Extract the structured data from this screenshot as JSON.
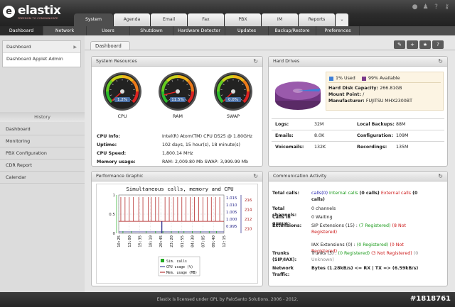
{
  "app": {
    "name": "elastix",
    "tagline": "FREEDOM TO COMMUNICATE"
  },
  "tabs": [
    {
      "label": "System",
      "active": true
    },
    {
      "label": "Agenda",
      "active": false
    },
    {
      "label": "Email",
      "active": false
    },
    {
      "label": "Fax",
      "active": false
    },
    {
      "label": "PBX",
      "active": false
    },
    {
      "label": "IM",
      "active": false
    },
    {
      "label": "Reports",
      "active": false
    }
  ],
  "top_icons": [
    "drop-icon",
    "user-icon",
    "question-icon",
    "key-icon"
  ],
  "subnav": [
    {
      "label": "Dashboard",
      "active": true
    },
    {
      "label": "Network",
      "active": false
    },
    {
      "label": "Users",
      "active": false
    },
    {
      "label": "Shutdown",
      "active": false
    },
    {
      "label": "Hardware Detector",
      "active": false
    },
    {
      "label": "Updates",
      "active": false
    },
    {
      "label": "Backup/Restore",
      "active": false
    },
    {
      "label": "Preferences",
      "active": false
    }
  ],
  "sidebar": {
    "items": [
      "Dashboard",
      "Dashboard Applet Admin"
    ],
    "history_title": "History",
    "history": [
      "Dashboard",
      "Monitoring",
      "PBX Configuration",
      "CDR Report",
      "Calendar"
    ]
  },
  "dashboard": {
    "tab_label": "Dashboard"
  },
  "system": {
    "title": "System Resources",
    "gauges": [
      {
        "label": "CPU",
        "value_text": "1.2%",
        "percent": 1.2
      },
      {
        "label": "RAM",
        "value_text": "11.5%",
        "percent": 11.5
      },
      {
        "label": "SWAP",
        "value_text": "0.0%",
        "percent": 0.0
      }
    ],
    "info": [
      {
        "key": "CPU Info:",
        "value": "Intel(R) Atom(TM) CPU D525 @ 1.80GHz"
      },
      {
        "key": "Uptime:",
        "value": "102 days, 15 hour(s), 18 minute(s)"
      },
      {
        "key": "CPU Speed:",
        "value": "1,800.14 MHz"
      },
      {
        "key": "Memory usage:",
        "value": "RAM: 2,009.80 Mb SWAP: 3,999.99 Mb"
      }
    ]
  },
  "harddrive": {
    "title": "Hard Drives",
    "used_label": "1% Used",
    "avail_label": "99% Available",
    "used_color": "#3f7fd8",
    "avail_color": "#7a3a8a",
    "capacity_label": "Hard Disk Capacity:",
    "capacity": "266.81GB",
    "mount_label": "Mount Point:",
    "mount": "/",
    "maker_label": "Manufacturer:",
    "maker": "FUJITSU MHX2300BT",
    "stats": [
      {
        "key": "Logs:",
        "value": "32M"
      },
      {
        "key": "Local Backups:",
        "value": "88M"
      },
      {
        "key": "Emails:",
        "value": "8.0K"
      },
      {
        "key": "Configuration:",
        "value": "109M"
      },
      {
        "key": "Voicemails:",
        "value": "132K"
      },
      {
        "key": "Recordings:",
        "value": "135M"
      }
    ]
  },
  "performance": {
    "title": "Performance Graphic"
  },
  "chart_data": {
    "type": "line",
    "title": "Simultaneous calls, memory and CPU",
    "x_ticks": [
      "10:25",
      "13:00",
      "15:35",
      "18:10",
      "20:45",
      "23:20",
      "01:55",
      "04:30",
      "07:05",
      "09:40",
      "12:15"
    ],
    "y_left": {
      "ticks": [
        "0",
        "0.5",
        "1"
      ],
      "ylim": [
        0,
        1
      ]
    },
    "y_mid": {
      "ticks": [
        "0.995",
        "1.000",
        "1.005",
        "1.010",
        "1.015"
      ],
      "ylim": [
        0.99,
        1.017
      ]
    },
    "y_right": {
      "ticks": [
        "210",
        "212",
        "214",
        "216"
      ],
      "ylim": [
        209,
        217
      ]
    },
    "legend": [
      "Sim. calls",
      "CPU usage (%)",
      "Mem. usage (MB)"
    ],
    "colors": [
      "#22aa22",
      "#222288",
      "#aa1111"
    ],
    "grid": true,
    "legend_position": "bottom",
    "sim_calls_spikes": [
      0.04,
      0.12,
      0.26,
      0.35,
      0.42,
      0.5,
      0.57,
      0.62,
      0.7,
      0.78,
      0.86,
      0.93
    ],
    "cpu_dips": [
      0.41
    ],
    "mem_base": 211.5,
    "mem_spikes": [
      0.02,
      0.06,
      0.1,
      0.14,
      0.19,
      0.23,
      0.28,
      0.31,
      0.35,
      0.38,
      0.44,
      0.48,
      0.52,
      0.56,
      0.6,
      0.64,
      0.68,
      0.72,
      0.76,
      0.8,
      0.84,
      0.88,
      0.92,
      0.96
    ]
  },
  "communication": {
    "title": "Communication Activity",
    "total_calls": {
      "key": "Total calls:",
      "internal_num": "calls(0)",
      "internal": "Internal calls",
      "mid": "(0 calls)",
      "external": "External calls",
      "tail": "(0 calls)"
    },
    "total_channels": {
      "key": "Total channels:",
      "value": "0 channels"
    },
    "queue": {
      "key": "Calls in queue:",
      "value": "0 Waiting"
    },
    "extensions": {
      "key": "Extensions:",
      "sip": "SIP Extensions (15) :",
      "sip_reg": "(7 Registered)",
      "sip_unreg": "(8 Not Registered)",
      "iax": "IAX Extensions (0) :",
      "iax_reg": "(0 Registered)",
      "iax_unreg": "(0 Not Registered)"
    },
    "trunks": {
      "key": "Trunks (SIP/IAX):",
      "base": "Trunks (3) :",
      "reg": "(0 Registered)",
      "unreg": "(3 Not Registered)",
      "unknown": "(0 Unknown)"
    },
    "traffic": {
      "key": "Network Traffic:",
      "value": "Bytes (1.28kB/s) <= RX | TX => (6.59kB/s)"
    }
  },
  "footer": {
    "text": "Elastix is licensed under GPL by PaloSanto Solutions. 2006 - 2012."
  },
  "watermark": "#1818761"
}
